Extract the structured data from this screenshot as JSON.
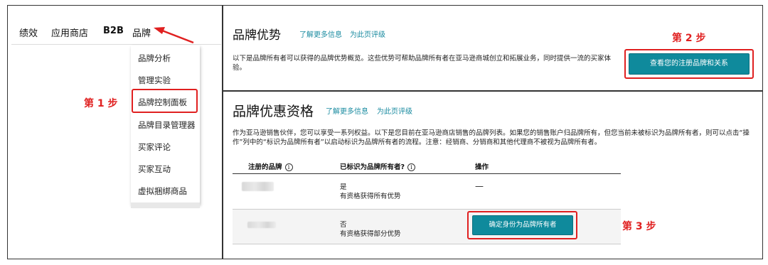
{
  "top_nav": {
    "items": [
      "绩效",
      "应用商店",
      "B2B",
      "品牌"
    ]
  },
  "brand_menu": {
    "items": [
      "品牌分析",
      "管理实验",
      "品牌控制面板",
      "品牌目录管理器",
      "买家评论",
      "买家互动",
      "虚拟捆绑商品"
    ]
  },
  "steps": {
    "step1": "第 1 步",
    "step2": "第 2 步",
    "step3": "第 3 步"
  },
  "brand_benefits": {
    "title": "品牌优势",
    "link_more": "了解更多信息",
    "link_rate": "为此页评级",
    "description": "以下是品牌所有者可以获得的品牌优势概览。这些优势可帮助品牌所有者在亚马逊商城创立和拓展业务，同时提供一流的买家体验。",
    "button_label": "查看您的注册品牌和关系"
  },
  "brand_eligibility": {
    "title": "品牌优惠资格",
    "link_more": "了解更多信息",
    "link_rate": "为此页评级",
    "description": "作为亚马逊销售伙伴，您可以享受一系列权益。以下是您目前在亚马逊商店销售的品牌列表。如果您的销售账户归品牌所有，但您当前未被标识为品牌所有者，则可以点击“操作”列中的“标识为品牌所有者”以启动标识为品牌所有者的流程。注意：经销商、分销商和其他代理商不被视为品牌所有者。",
    "table": {
      "headers": [
        "注册的品牌",
        "已标识为品牌所有者?",
        "操作"
      ],
      "rows": [
        {
          "owner_status": "是",
          "eligibility": "有资格获得所有优势",
          "action": "—"
        },
        {
          "owner_status": "否",
          "eligibility": "有资格获得部分优势",
          "action": "确定身份为品牌所有者"
        }
      ]
    }
  }
}
